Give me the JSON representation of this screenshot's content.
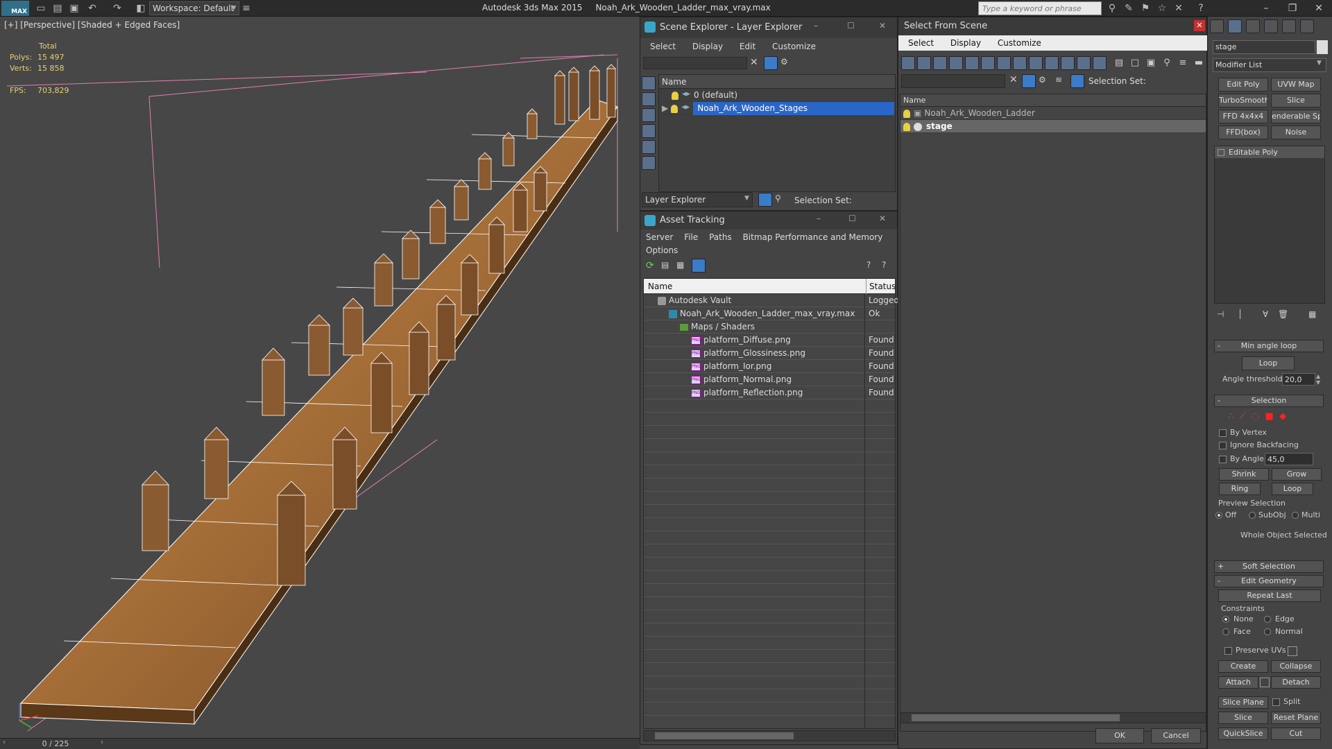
{
  "app": {
    "logo": "MAX",
    "workspace": "Workspace: Default",
    "title": "Autodesk 3ds Max  2015",
    "filename": "Noah_Ark_Wooden_Ladder_max_vray.max",
    "search_placeholder": "Type a keyword or phrase"
  },
  "viewport": {
    "label": "[+] [Perspective] [Shaded + Edged Faces]",
    "stats_total": "Total",
    "polys_label": "Polys:",
    "polys_value": "15 497",
    "verts_label": "Verts:",
    "verts_value": "15 858",
    "fps_label": "FPS:",
    "fps_value": "703,829",
    "frame": "0 / 225"
  },
  "scene_explorer": {
    "title": "Scene Explorer - Layer Explorer",
    "menu": [
      "Select",
      "Display",
      "Edit",
      "Customize"
    ],
    "col_name": "Name",
    "rows": [
      "0 (default)",
      "Noah_Ark_Wooden_Stages"
    ],
    "bottom_label": "Layer Explorer",
    "selection_set": "Selection Set:"
  },
  "asset_tracking": {
    "title": "Asset Tracking",
    "menu": [
      "Server",
      "File",
      "Paths",
      "Bitmap Performance and Memory"
    ],
    "menu2": "Options",
    "col_name": "Name",
    "col_status": "Status",
    "rows": [
      {
        "name": "Autodesk Vault",
        "status": "Logged"
      },
      {
        "name": "Noah_Ark_Wooden_Ladder_max_vray.max",
        "status": "Ok"
      },
      {
        "name": "Maps / Shaders",
        "status": ""
      },
      {
        "name": "platform_Diffuse.png",
        "status": "Found"
      },
      {
        "name": "platform_Glossiness.png",
        "status": "Found"
      },
      {
        "name": "platform_Ior.png",
        "status": "Found"
      },
      {
        "name": "platform_Normal.png",
        "status": "Found"
      },
      {
        "name": "platform_Reflection.png",
        "status": "Found"
      }
    ]
  },
  "select_from_scene": {
    "title": "Select From Scene",
    "menu": [
      "Select",
      "Display",
      "Customize"
    ],
    "selection_set": "Selection Set:",
    "col_name": "Name",
    "rows": [
      "Noah_Ark_Wooden_Ladder",
      "stage"
    ],
    "ok": "OK",
    "cancel": "Cancel"
  },
  "command_panel": {
    "object_name": "stage",
    "modifier_list": "Modifier List",
    "buttons": [
      "Edit Poly",
      "UVW Map",
      "TurboSmooth",
      "Slice",
      "FFD 4x4x4",
      "enderable Splin",
      "FFD(box)",
      "Noise"
    ],
    "stack_item": "Editable Poly",
    "min_angle_loop": "Min angle loop",
    "loop": "Loop",
    "angle_threshold_label": "Angle threshold:",
    "angle_threshold_value": "20,0",
    "selection": "Selection",
    "by_vertex": "By Vertex",
    "ignore_backfacing": "Ignore Backfacing",
    "by_angle": "By Angle:",
    "by_angle_value": "45,0",
    "shrink": "Shrink",
    "grow": "Grow",
    "ring": "Ring",
    "loop2": "Loop",
    "preview_selection": "Preview Selection",
    "off": "Off",
    "subobj": "SubObj",
    "multi": "Multi",
    "whole_object": "Whole Object Selected",
    "soft_selection": "Soft Selection",
    "edit_geometry": "Edit Geometry",
    "repeat_last": "Repeat Last",
    "constraints": "Constraints",
    "none": "None",
    "edge": "Edge",
    "face": "Face",
    "normal": "Normal",
    "preserve_uvs": "Preserve UVs",
    "create": "Create",
    "collapse": "Collapse",
    "attach": "Attach",
    "detach": "Detach",
    "slice_plane": "Slice Plane",
    "split": "Split",
    "slice": "Slice",
    "reset_plane": "Reset Plane",
    "quickslice": "QuickSlice",
    "cut": "Cut"
  }
}
